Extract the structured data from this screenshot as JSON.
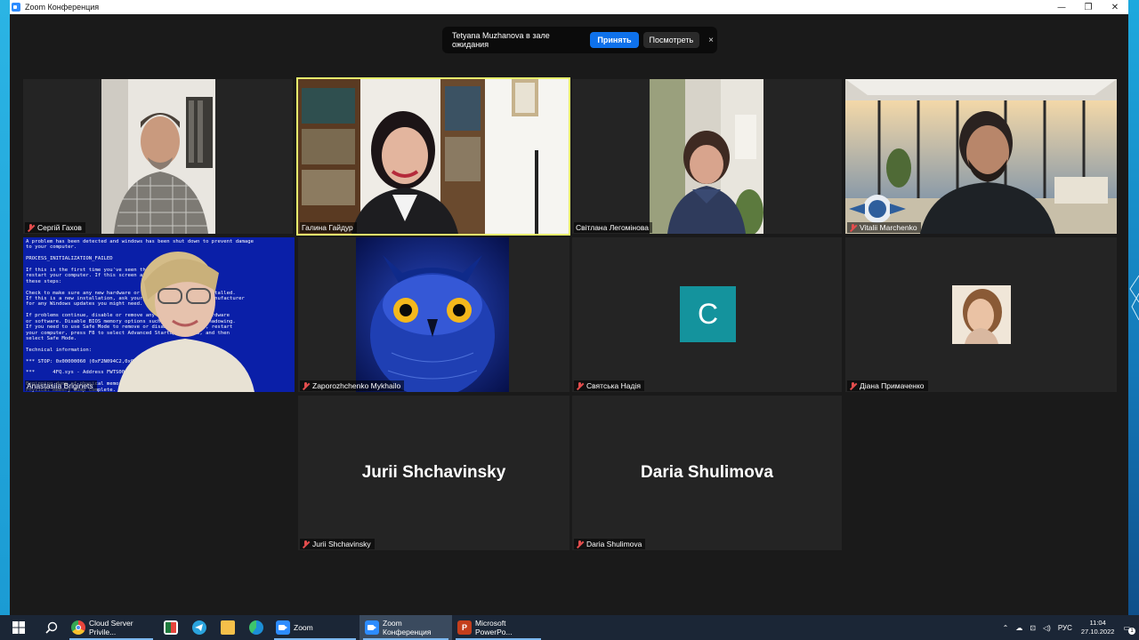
{
  "window": {
    "title": "Zoom Конференция",
    "controls": {
      "minimize": "—",
      "maximize": "❐",
      "close": "✕"
    }
  },
  "notification": {
    "message": "Tetyana Muzhanova в зале ожидания",
    "accept_label": "Принять",
    "view_label": "Посмотреть",
    "close_label": "×"
  },
  "participants": [
    {
      "name": "Сергій Гахов",
      "muted": true,
      "video": true
    },
    {
      "name": "Галина Гайдур",
      "muted": false,
      "video": true,
      "active_speaker": true
    },
    {
      "name": "Світлана Легомінова",
      "muted": false,
      "video": true
    },
    {
      "name": "Vitalii Marchenko",
      "muted": true,
      "video": true
    },
    {
      "name": "Anastasiia Briginets",
      "muted": false,
      "video": true
    },
    {
      "name": "Zaporozhchenko Mykhailo",
      "muted": true,
      "video": true
    },
    {
      "name": "Святська Надія",
      "muted": true,
      "video": false,
      "avatar_letter": "C",
      "avatar_color": "#14939d"
    },
    {
      "name": "Діана Примаченко",
      "muted": true,
      "video": false
    },
    {
      "name": "Jurii Shchavinsky",
      "muted": true,
      "video": false,
      "display_name": "Jurii Shchavinsky"
    },
    {
      "name": "Daria Shulimova",
      "muted": true,
      "video": false,
      "display_name": "Daria Shulimova"
    }
  ],
  "bsod": {
    "lines": "A problem has been detected and windows has been shut down to prevent damage\nto your computer.\n\nPROCESS_INITIALIZATION_FAILED\n\nIf this is the first time you've seen this Stop error screen,\nrestart your computer. If this screen appears again, follow\nthese steps:\n\nCheck to make sure any new hardware or software is properly installed.\nIf this is a new installation, ask your hardware or software manufacturer\nfor any Windows updates you might need.\n\nIf problems continue, disable or remove any newly installed hardware\nor software. Disable BIOS memory options such as caching or shadowing.\nIf you need to use Safe Mode to remove or disable components, restart\nyour computer, press F8 to select Advanced Startup Options, and then\nselect Safe Mode.\n\nTechnical information:\n\n*** STOP: 0x00000060 (0xF2N094C2,0x0000000C,0x00000000,0x00000000)\n\n***      4FQ.sys - Address FWTS0000 base at 4s800000, Datestamp 4d5dd88c\n\nBeginning dump of physical memory\nPhysical memory dump complete.\nContact your system administrator"
  },
  "taskbar": {
    "apps": [
      {
        "label": "Cloud Server Privile...",
        "icon": "chrome-icon",
        "color": "#e8453c",
        "open": true
      },
      {
        "label": "",
        "icon": "excel-like-icon",
        "color": "#1f7a3d",
        "open": false
      },
      {
        "label": "",
        "icon": "telegram-icon",
        "color": "#2aa3dd",
        "open": false
      },
      {
        "label": "",
        "icon": "folder-icon",
        "color": "#f5c04a",
        "open": false
      },
      {
        "label": "",
        "icon": "edge-icon",
        "color": "#1c8fd7",
        "open": false
      },
      {
        "label": "Zoom",
        "icon": "zoom-icon",
        "color": "#2d8cff",
        "open": true
      },
      {
        "label": "Zoom Конференция",
        "icon": "zoom-icon",
        "color": "#2d8cff",
        "open": true,
        "active": true
      },
      {
        "label": "Microsoft PowerPo...",
        "icon": "powerpoint-icon",
        "color": "#c43e1c",
        "open": true
      }
    ],
    "tray": {
      "lang": "РУС",
      "time": "11:04",
      "date": "27.10.2022",
      "notifications": "1"
    }
  }
}
